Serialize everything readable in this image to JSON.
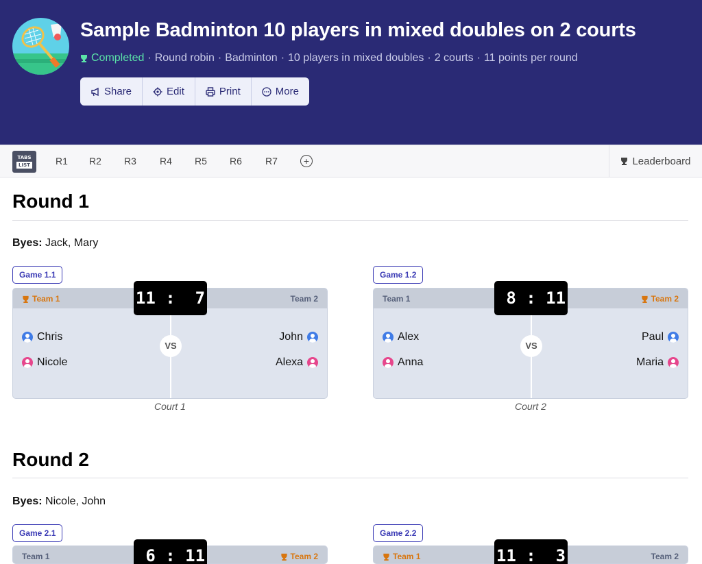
{
  "header": {
    "title": "Sample Badminton 10 players in mixed doubles on 2 courts",
    "status": "Completed",
    "meta": [
      "Round robin",
      "Badminton",
      "10 players in mixed doubles",
      "2 courts",
      "11 points per round"
    ],
    "sep": "·",
    "buttons": {
      "share": "Share",
      "edit": "Edit",
      "print": "Print",
      "more": "More"
    }
  },
  "tabbar": {
    "toggle_top": "TABS",
    "toggle_bottom": "LIST",
    "tabs": [
      "R1",
      "R2",
      "R3",
      "R4",
      "R5",
      "R6",
      "R7"
    ],
    "add": "+",
    "leaderboard": "Leaderboard"
  },
  "rounds": [
    {
      "title": "Round 1",
      "byes_label": "Byes:",
      "byes": "Jack, Mary",
      "games": [
        {
          "badge": "Game 1.1",
          "team1_label": "Team 1",
          "team2_label": "Team 2",
          "winner": "team1",
          "score": "11 :  7",
          "vs": "VS",
          "team1": [
            "Chris",
            "Nicole"
          ],
          "team2": [
            "John",
            "Alexa"
          ],
          "court": "Court 1"
        },
        {
          "badge": "Game 1.2",
          "team1_label": "Team 1",
          "team2_label": "Team 2",
          "winner": "team2",
          "score": " 8 : 11",
          "vs": "VS",
          "team1": [
            "Alex",
            "Anna"
          ],
          "team2": [
            "Paul",
            "Maria"
          ],
          "court": "Court 2"
        }
      ]
    },
    {
      "title": "Round 2",
      "byes_label": "Byes:",
      "byes": "Nicole, John",
      "games": [
        {
          "badge": "Game 2.1",
          "team1_label": "Team 1",
          "team2_label": "Team 2",
          "winner": "team2",
          "score": " 6 : 11"
        },
        {
          "badge": "Game 2.2",
          "team1_label": "Team 1",
          "team2_label": "Team 2",
          "winner": "team1",
          "score": "11 :  3"
        }
      ]
    }
  ],
  "colors": {
    "header_bg": "#2a2a75",
    "status": "#5be3a8",
    "winner": "#d8760f",
    "male": "#3f7be6",
    "female": "#e6468c"
  }
}
